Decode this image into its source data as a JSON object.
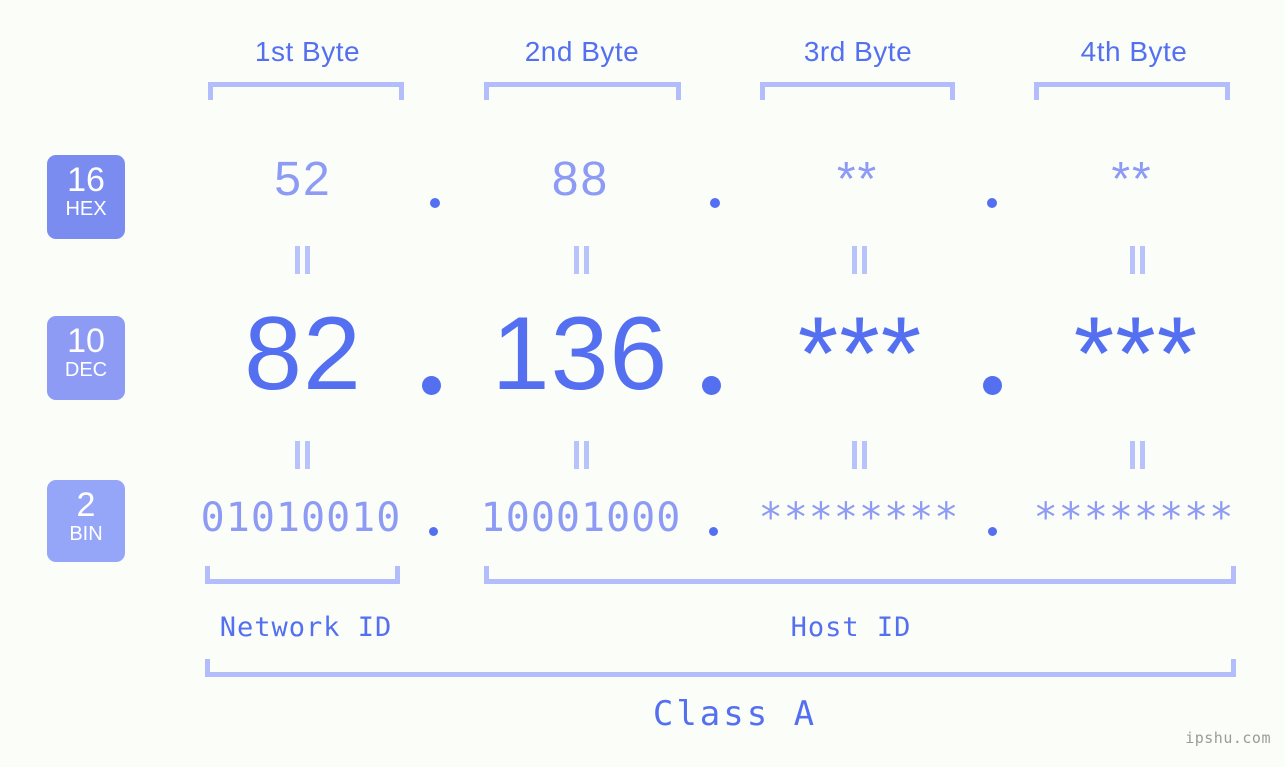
{
  "meta": {
    "background_color": "#fbfdf9",
    "accent_color": "#5470f0",
    "muted_accent_color": "#8d9bf4",
    "bracket_color": "#b3bdfb",
    "watermark": "ipshu.com"
  },
  "byte_headers": [
    {
      "label": "1st Byte"
    },
    {
      "label": "2nd Byte"
    },
    {
      "label": "3rd Byte"
    },
    {
      "label": "4th Byte"
    }
  ],
  "bases": [
    {
      "number": "16",
      "name": "HEX",
      "color": "#7b8cf0"
    },
    {
      "number": "10",
      "name": "DEC",
      "color": "#8d9bf4"
    },
    {
      "number": "2",
      "name": "BIN",
      "color": "#95a5f7"
    }
  ],
  "rows": {
    "hex": {
      "values": [
        "52",
        "88",
        "**",
        "**"
      ],
      "separator": "."
    },
    "dec": {
      "values": [
        "82",
        "136",
        "***",
        "***"
      ],
      "separator": "."
    },
    "bin": {
      "values": [
        "01010010",
        "10001000",
        "********",
        "********"
      ],
      "separator": "."
    }
  },
  "equals_symbol": "=",
  "segments": {
    "network_id": "Network ID",
    "host_id": "Host ID"
  },
  "class_label": "Class A"
}
